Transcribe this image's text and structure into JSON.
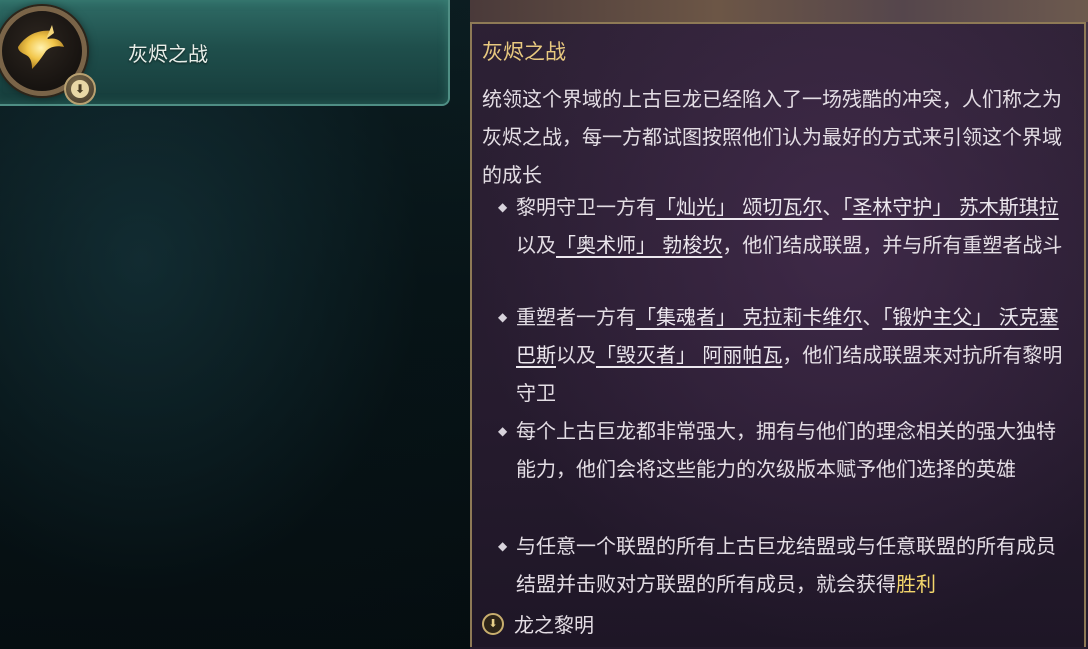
{
  "realm_list": {
    "selected_item": {
      "title": "灰烬之战",
      "icon": "golden-dragon-icon",
      "badge_icon": "download-arrow-icon"
    }
  },
  "tooltip": {
    "title": "灰烬之战",
    "intro": "统领这个界域的上古巨龙已经陷入了一场残酷的冲突，人们称之为灰烬之战，每一方都试图按照他们认为最好的方式来引领这个界域的成长",
    "bullets": [
      {
        "parts": [
          {
            "text": "黎明守卫一方有",
            "link": false
          },
          {
            "text": "「灿光」 颂切瓦尔",
            "link": true
          },
          {
            "text": "、",
            "link": false
          },
          {
            "text": "「圣林守护」 苏木斯琪拉",
            "link": true
          },
          {
            "text": "以及",
            "link": false
          },
          {
            "text": "「奥术师」 勃梭坎",
            "link": true
          },
          {
            "text": "，他们结成联盟，并与所有重塑者战斗",
            "link": false
          }
        ]
      },
      {
        "parts": [
          {
            "text": "重塑者一方有",
            "link": false
          },
          {
            "text": "「集魂者」 克拉莉卡维尔",
            "link": true
          },
          {
            "text": "、",
            "link": false
          },
          {
            "text": "「锻炉主父」 沃克塞巴斯",
            "link": true
          },
          {
            "text": "以及",
            "link": false
          },
          {
            "text": "「毁灭者」 阿丽帕瓦",
            "link": true
          },
          {
            "text": "，他们结成联盟来对抗所有黎明守卫",
            "link": false
          }
        ]
      },
      {
        "parts": [
          {
            "text": "每个上古巨龙都非常强大，拥有与他们的理念相关的强大独特能力，他们会将这些能力的次级版本赋予他们选择的英雄",
            "link": false
          }
        ]
      },
      {
        "parts": [
          {
            "text": "与任意一个联盟的所有上古巨龙结盟或与任意联盟的所有成员结盟并击败对方联盟的所有成员，就会获得",
            "link": false
          },
          {
            "text": "胜利",
            "link": false,
            "gold": true
          }
        ]
      }
    ],
    "footer": {
      "label": "龙之黎明",
      "icon": "download-arrow-icon"
    }
  },
  "colors": {
    "title_gold": "#e8c97f",
    "victory_yellow": "#f3d66b",
    "panel_border": "#8e7a56",
    "item_teal": "#2f6c66"
  }
}
